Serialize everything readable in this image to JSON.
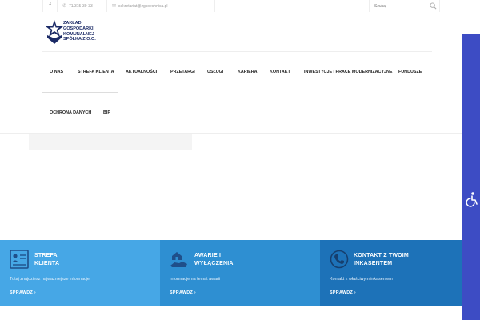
{
  "topbar": {
    "facebook_icon": "facebook-icon",
    "phone": "71/315-39-33",
    "email": "sekretariat@zgkoechnica.pl",
    "search_placeholder": "Szukaj"
  },
  "logo": {
    "lines": [
      "ZAKŁAD",
      "GOSPODARKI",
      "KOMUNALNEJ",
      "SPÓŁKA z o.o."
    ]
  },
  "nav": {
    "items": [
      "O NAS",
      "STREFA KLIENTA",
      "AKTUALNOŚCI",
      "PRZETARGI",
      "USŁUGI",
      "KARIERA",
      "KONTAKT",
      "INWESTYCJE I PRACE MODERNIZACYJNE",
      "FUNDUSZE",
      "OCHRONA DANYCH",
      "BIP"
    ]
  },
  "cards": [
    {
      "title_line1": "STREFA",
      "title_line2": "KLIENTA",
      "desc": "Tutaj znajdziesz najważniejsze informacje",
      "link": "SPRAWDŹ ›",
      "icon": "client-card-icon"
    },
    {
      "title_line1": "AWARIE I",
      "title_line2": "WYŁĄCZENIA",
      "desc": "Informacje na temat awarii",
      "link": "SPRAWDŹ ›",
      "icon": "hand-house-icon"
    },
    {
      "title_line1": "KONTAKT Z TWOIM",
      "title_line2": "INKASENTEM",
      "desc": "Kontakt z właściwym inkasentem",
      "link": "SPRAWDŹ ›",
      "icon": "phone-icon"
    }
  ],
  "colors": {
    "card1": "#46a7e6",
    "card2": "#2e8fd2",
    "card3": "#1d72b8",
    "accessibility": "#3d4cc4",
    "logo": "#1b2a66"
  }
}
